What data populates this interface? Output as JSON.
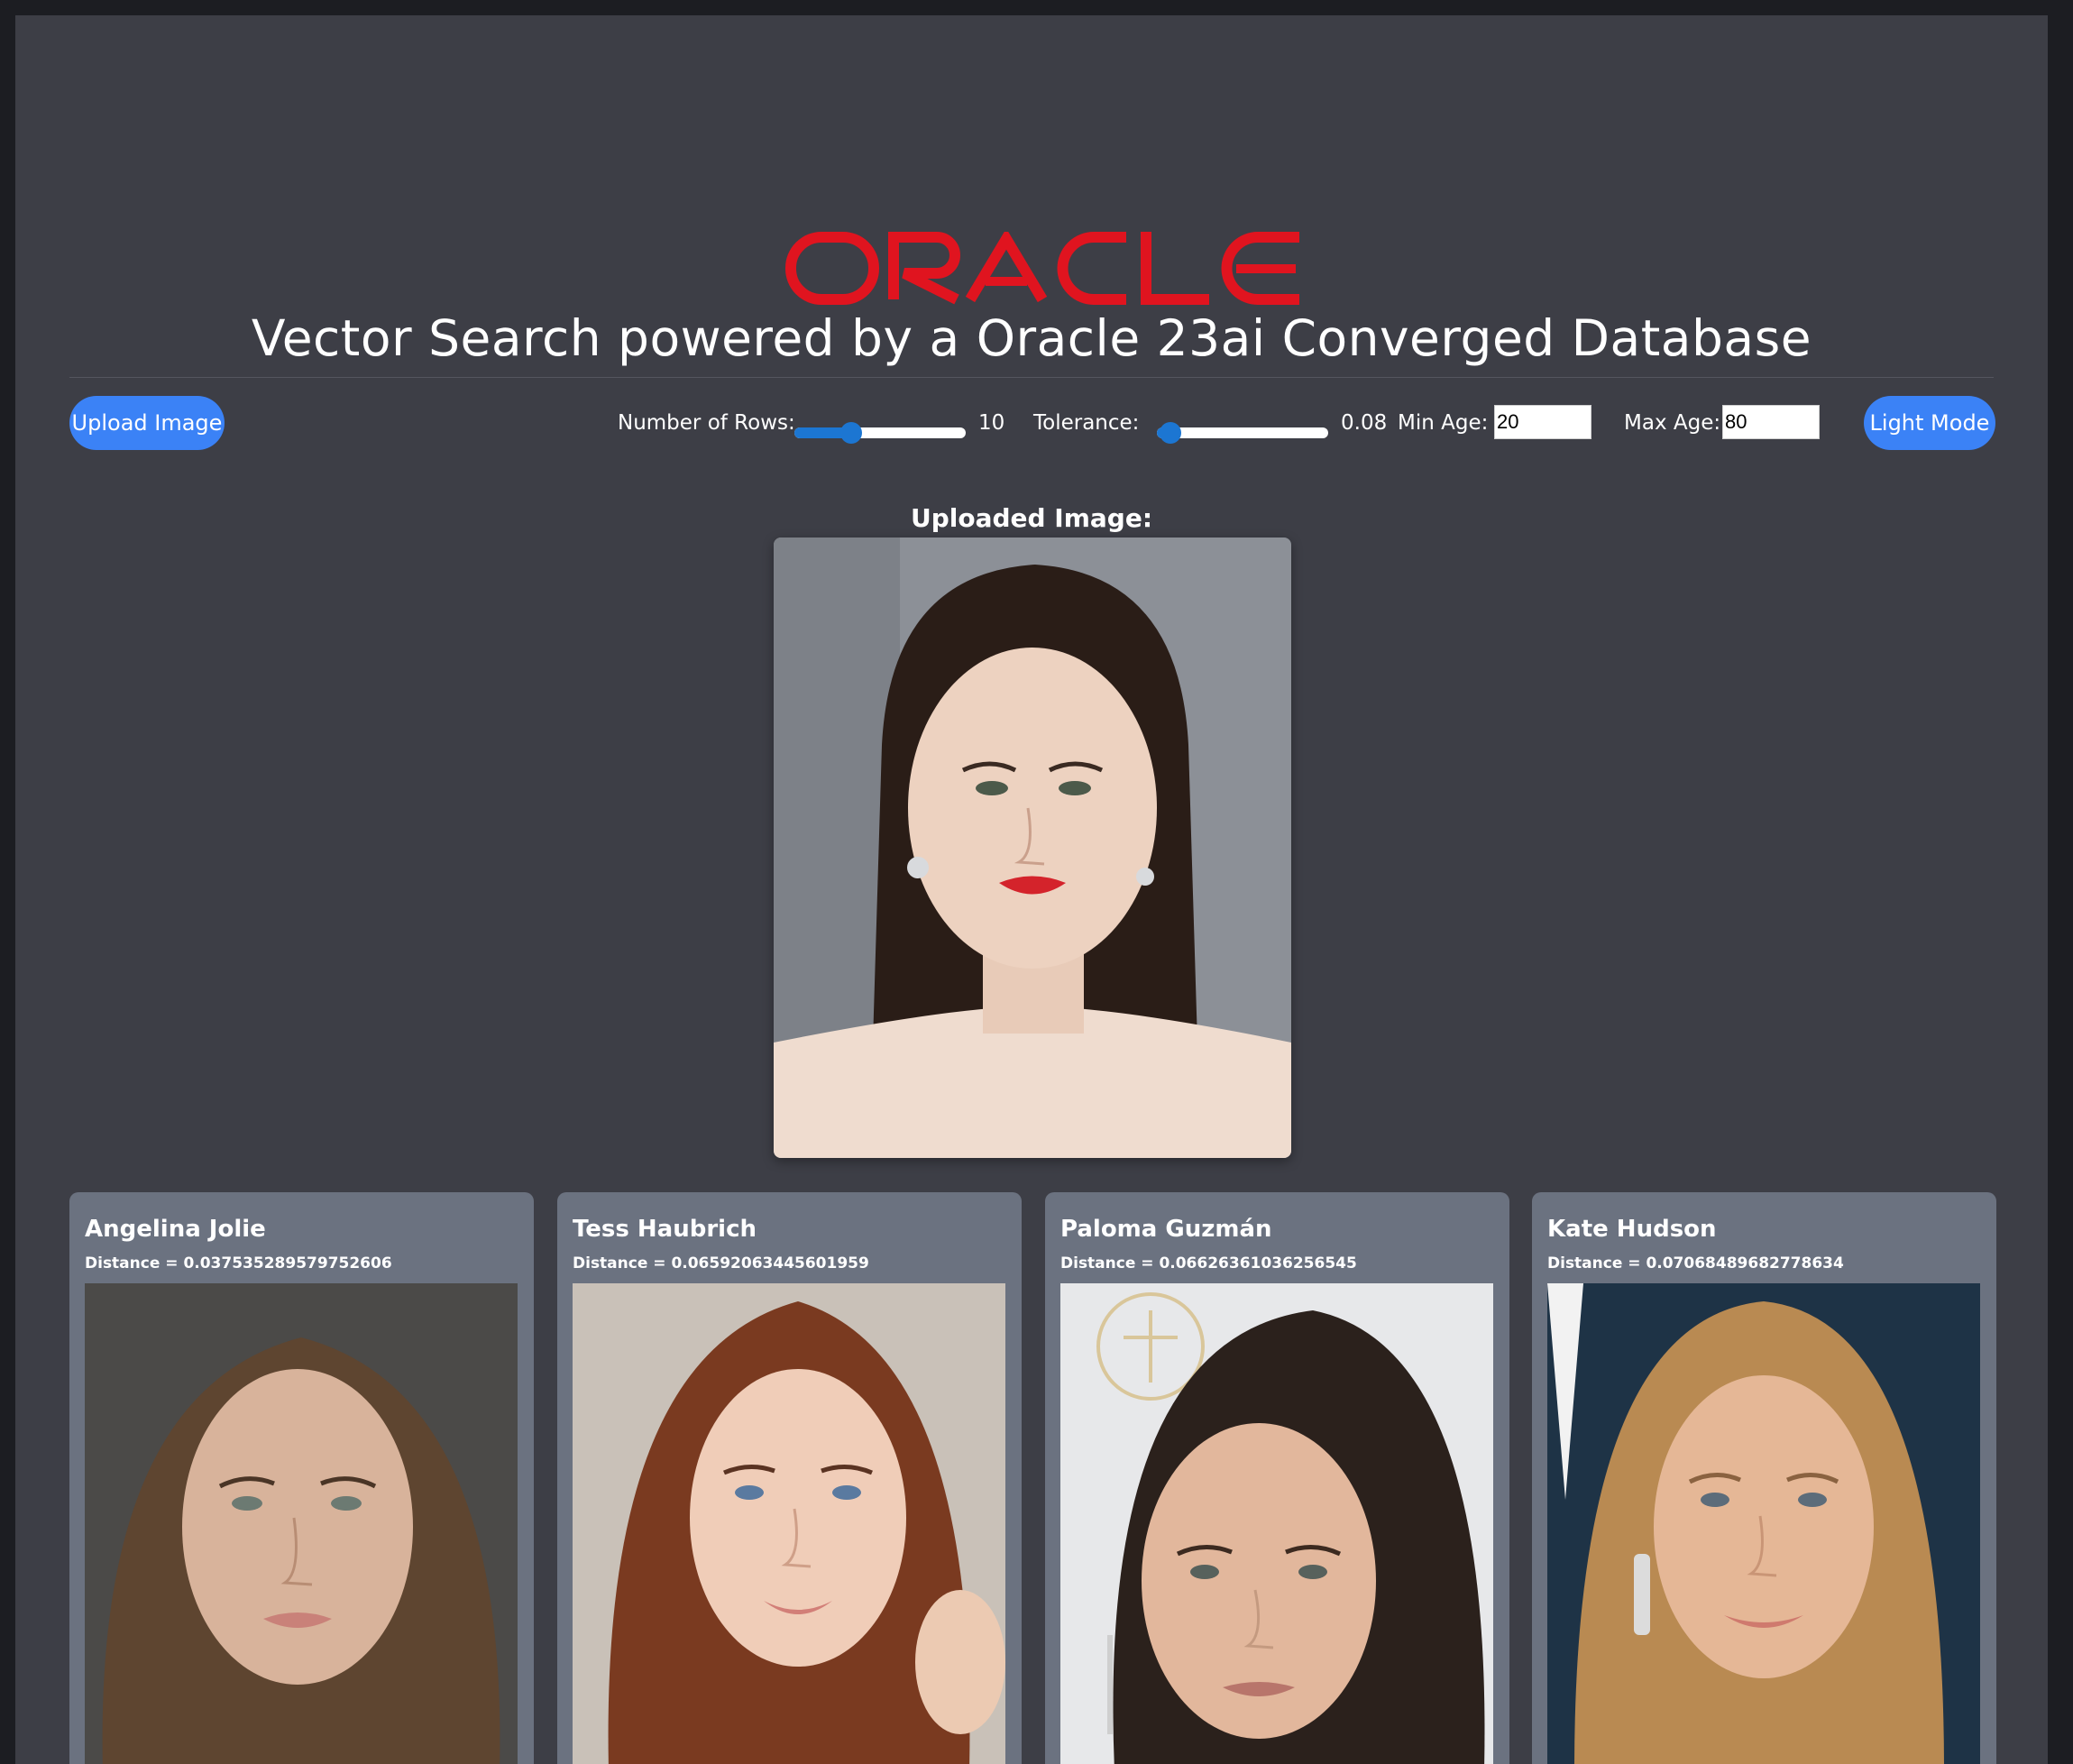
{
  "header": {
    "logo_text": "ORACLE",
    "subtitle": "Vector Search powered by a Oracle 23ai Converged Database"
  },
  "toolbar": {
    "upload_label": "Upload Image",
    "rows_label": "Number of Rows:",
    "rows_value": "10",
    "rows_fraction": 0.33,
    "tolerance_label": "Tolerance:",
    "tolerance_value": "0.08",
    "tolerance_fraction": 0.08,
    "min_age_label": "Min Age:",
    "min_age_value": "20",
    "max_age_label": "Max Age:",
    "max_age_value": "80",
    "mode_label": "Light Mode"
  },
  "uploaded": {
    "heading": "Uploaded Image:"
  },
  "results": [
    {
      "name": "Angelina Jolie",
      "distance": "Distance = 0.037535289579752606"
    },
    {
      "name": "Tess Haubrich",
      "distance": "Distance = 0.06592063445601959"
    },
    {
      "name": "Paloma Guzmán",
      "distance": "Distance = 0.06626361036256545"
    },
    {
      "name": "Kate Hudson",
      "distance": "Distance = 0.07068489682778634"
    }
  ],
  "colors": {
    "page_background": "#3d3e46",
    "accent_blue": "#3b82f6",
    "slider_blue": "#1c76d2",
    "oracle_red": "#e0141f",
    "card_background": "#6b7280"
  }
}
